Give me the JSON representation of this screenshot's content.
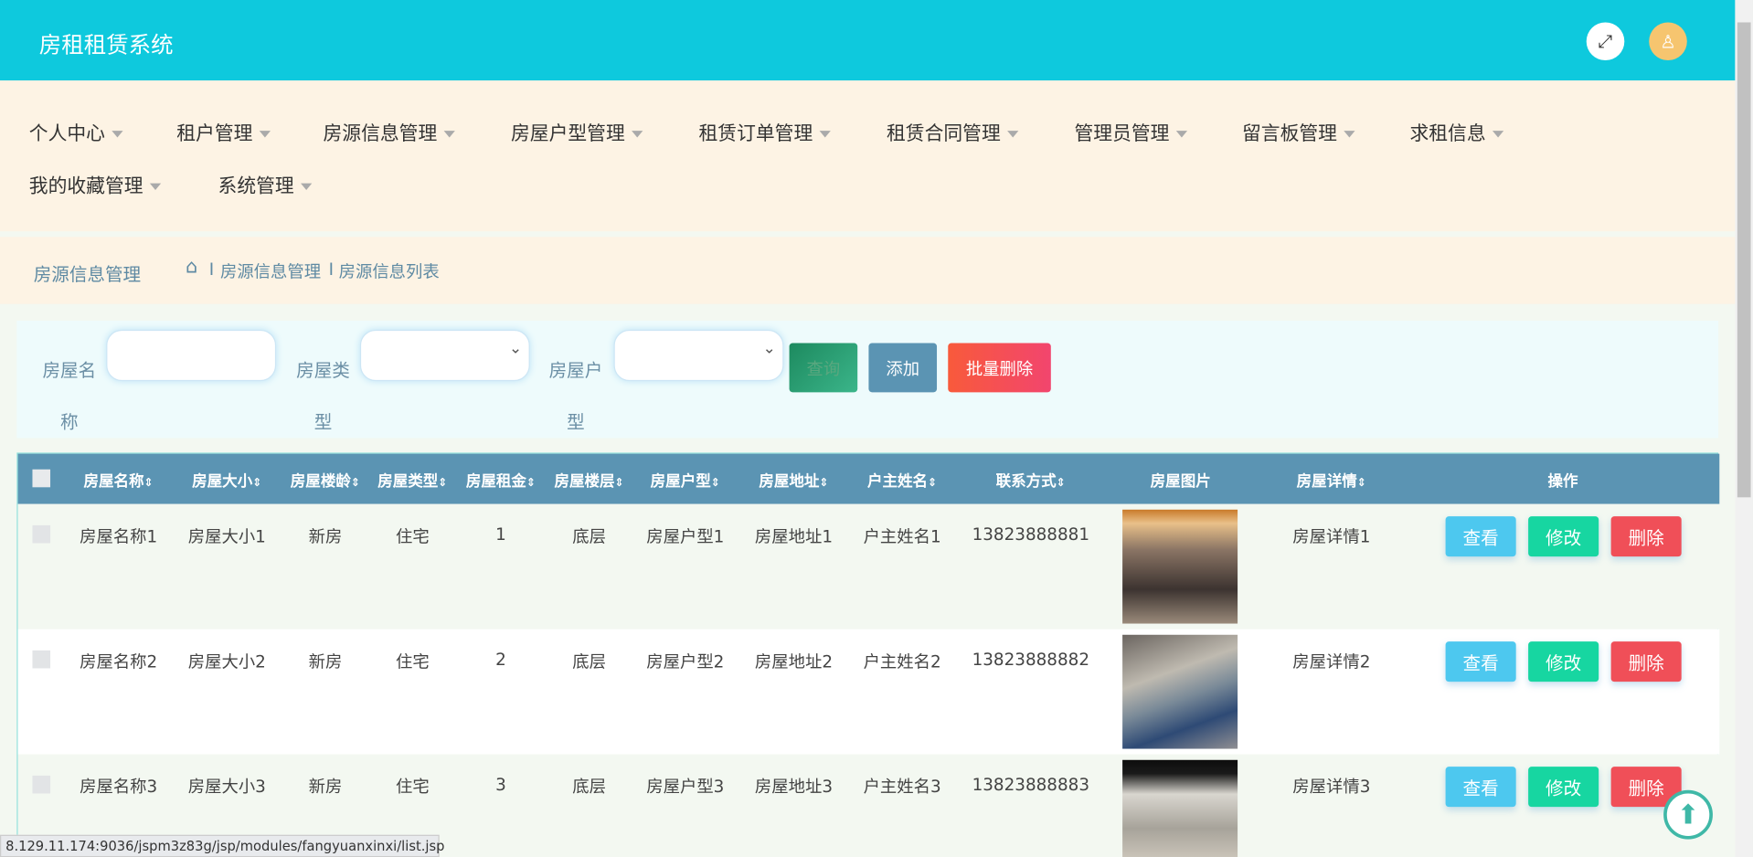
{
  "header": {
    "title": "房租租赁系统",
    "fullscreen_icon": "expand-icon",
    "user_icon": "user-icon",
    "accent": "#0ec9dd"
  },
  "nav": [
    "个人中心",
    "租户管理",
    "房源信息管理",
    "房屋户型管理",
    "租赁订单管理",
    "租赁合同管理",
    "管理员管理",
    "留言板管理",
    "求租信息",
    "我的收藏管理",
    "系统管理"
  ],
  "breadcrumb": {
    "title": "房源信息管理",
    "sep": "I",
    "path1": "房源信息管理",
    "path2": "房源信息列表"
  },
  "search": {
    "name_label": "房屋名称",
    "type_label": "房屋类型",
    "layout_label": "房屋户型",
    "query": "查询",
    "add": "添加",
    "batch_delete": "批量删除"
  },
  "table": {
    "headers": [
      "房屋名称",
      "房屋大小",
      "房屋楼龄",
      "房屋类型",
      "房屋租金",
      "房屋楼层",
      "房屋户型",
      "房屋地址",
      "户主姓名",
      "联系方式",
      "房屋图片",
      "房屋详情",
      "操作"
    ],
    "sort_mark": "⇕",
    "rows": [
      [
        "房屋名称1",
        "房屋大小1",
        "新房",
        "住宅",
        "1",
        "底层",
        "房屋户型1",
        "房屋地址1",
        "户主姓名1",
        "13823888881",
        "房屋详情1"
      ],
      [
        "房屋名称2",
        "房屋大小2",
        "新房",
        "住宅",
        "2",
        "底层",
        "房屋户型2",
        "房屋地址2",
        "户主姓名2",
        "13823888882",
        "房屋详情2"
      ],
      [
        "房屋名称3",
        "房屋大小3",
        "新房",
        "住宅",
        "3",
        "底层",
        "房屋户型3",
        "房屋地址3",
        "户主姓名3",
        "13823888883",
        "房屋详情3"
      ]
    ],
    "actions": {
      "view": "查看",
      "edit": "修改",
      "delete": "删除"
    }
  },
  "status_url": "8.129.11.174:9036/jspm3z83g/jsp/modules/fangyuanxinxi/list.jsp"
}
